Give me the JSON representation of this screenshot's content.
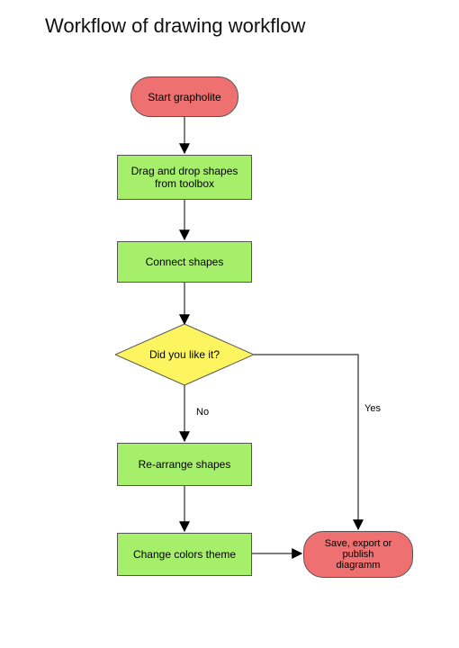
{
  "title": "Workflow of drawing workflow",
  "nodes": {
    "start": {
      "label": "Start grapholite"
    },
    "drag": {
      "label": "Drag and drop shapes\nfrom toolbox"
    },
    "connect": {
      "label": "Connect shapes"
    },
    "decide": {
      "label": "Did you like it?"
    },
    "rearrange": {
      "label": "Re-arrange shapes"
    },
    "recolor": {
      "label": "Change colors theme"
    },
    "save": {
      "label": "Save, export or\npublish\ndiagramm"
    }
  },
  "edges": {
    "no": {
      "label": "No"
    },
    "yes": {
      "label": "Yes"
    }
  },
  "colors": {
    "terminator": "#ef7070",
    "process": "#a6ef6b",
    "decision": "#fdf560"
  }
}
